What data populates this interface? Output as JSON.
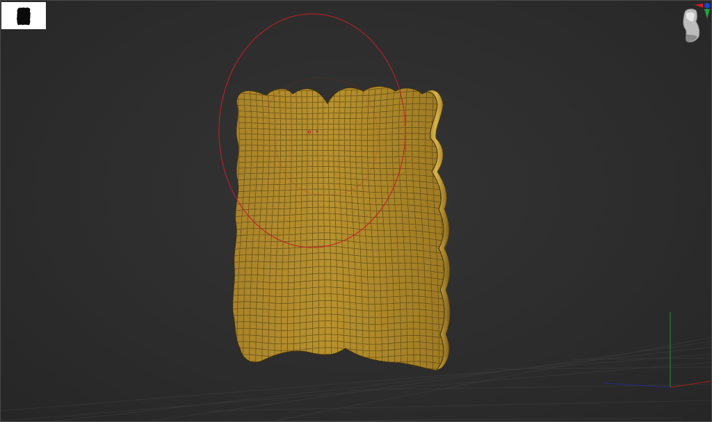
{
  "viewport": {
    "background_color": "#2d2d2d",
    "mesh_color": "#b8922e",
    "wire_color": "#5a4615",
    "brush_color": "#c0202a",
    "axis_x_color": "#a02020",
    "axis_y_color": "#2f8f3f",
    "axis_z_color": "#2a2a8a"
  },
  "navigator": {
    "icon": "mesh-silhouette-icon"
  },
  "orientation_widget": {
    "icon": "orientation-head-icon",
    "axes": [
      "x-axis-red",
      "y-axis-green",
      "z-axis-blue"
    ]
  }
}
